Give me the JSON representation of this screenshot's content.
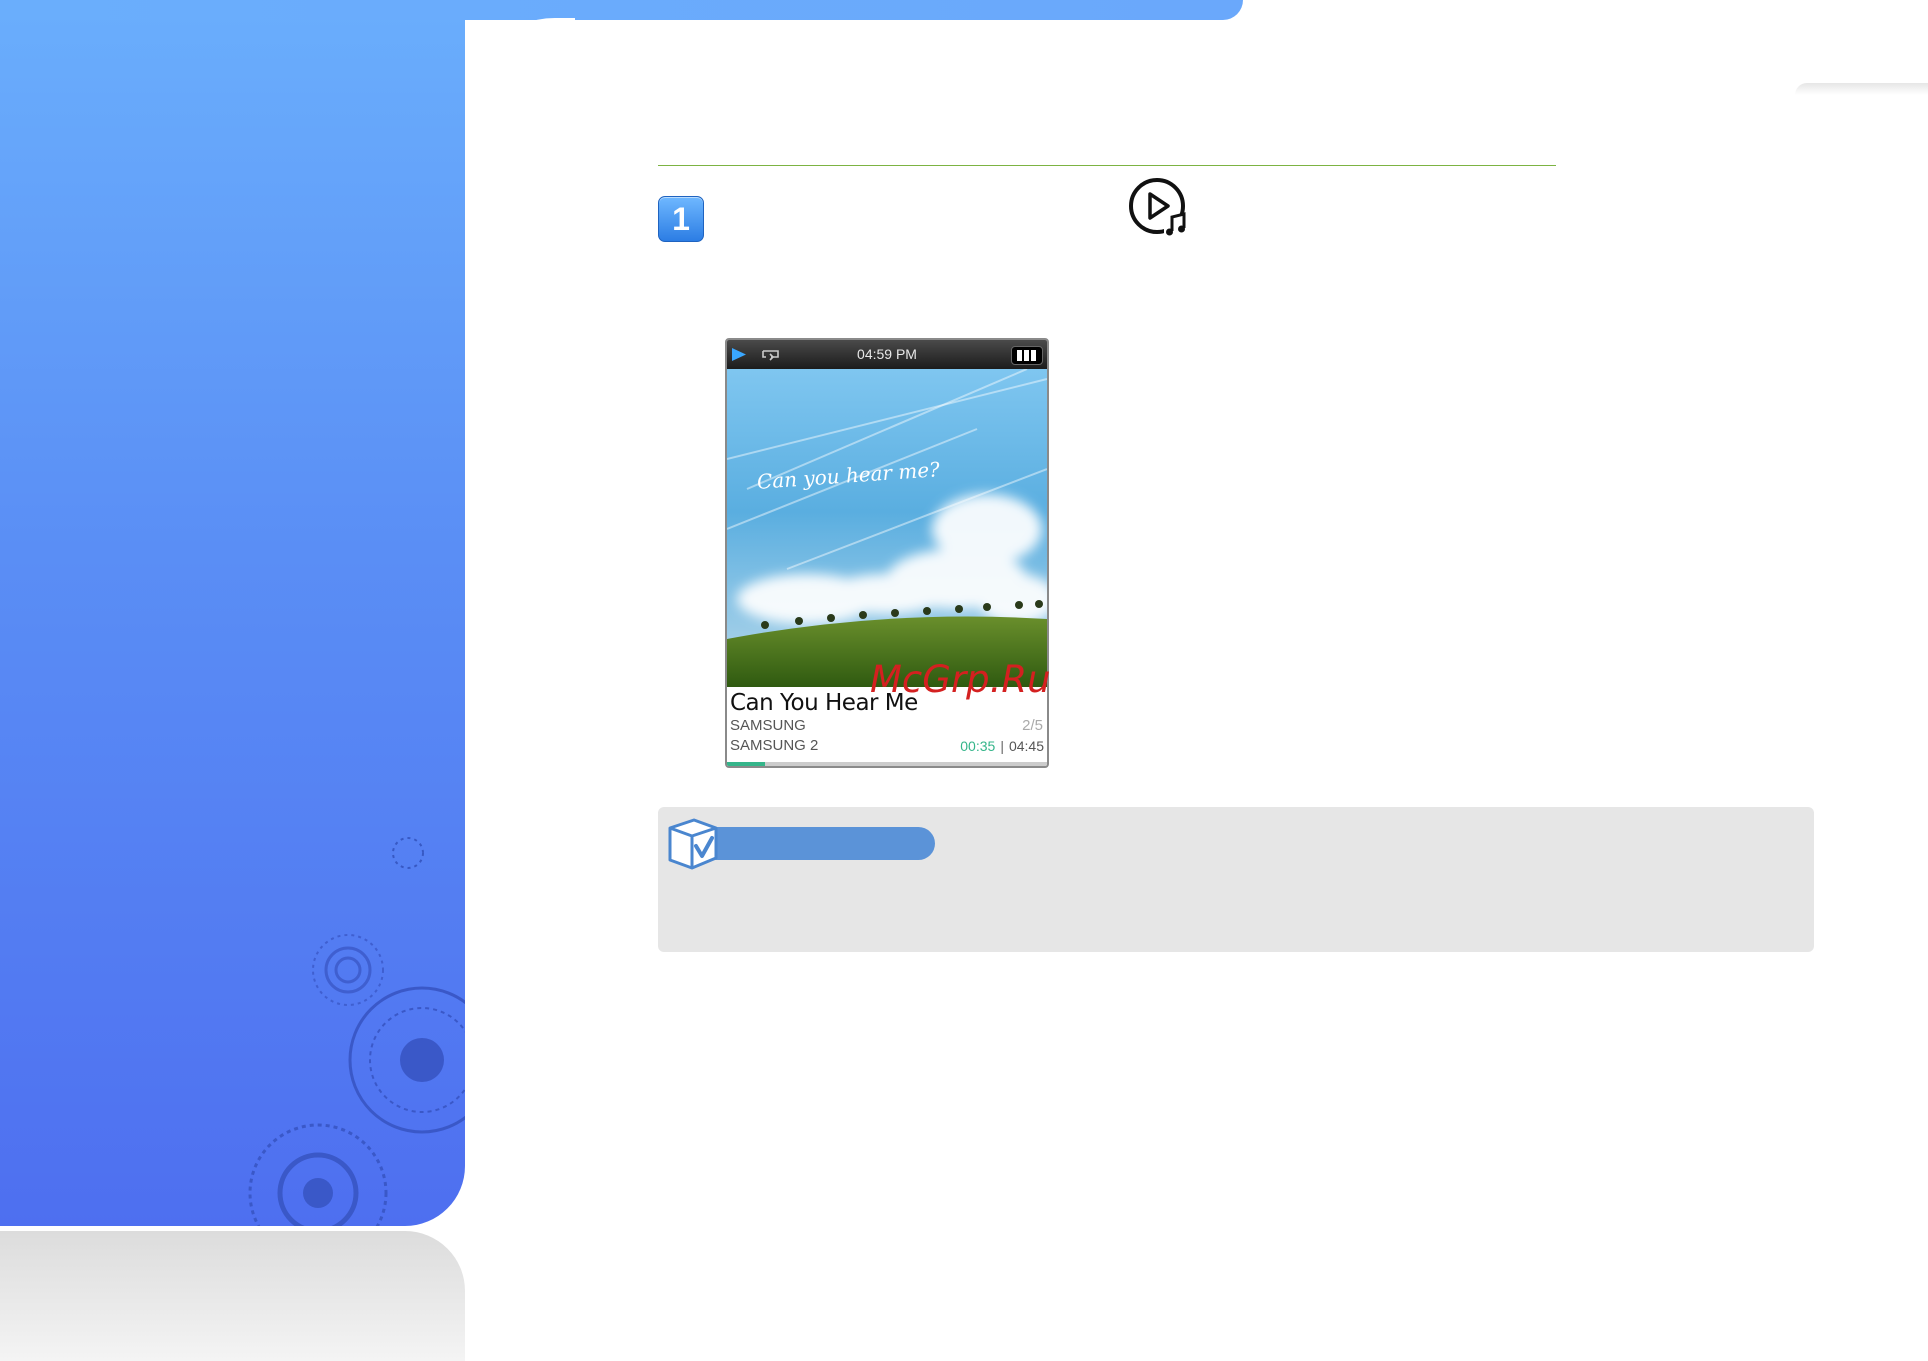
{
  "step": {
    "number": "1"
  },
  "device": {
    "status_time": "04:59 PM",
    "artwork_caption": "Can you hear me?",
    "song_title": "Can You Hear Me",
    "artist": "SAMSUNG",
    "album": "SAMSUNG 2",
    "track_count": "2/5",
    "elapsed": "00:35",
    "separator": "|",
    "total": "04:45",
    "progress": 0.12
  },
  "watermark": "McGrp.Ru",
  "icons": {
    "step_icon": "number-1-icon",
    "mode_icon": "music-play-icon",
    "note_icon": "checkbox-cube-icon"
  },
  "colors": {
    "sidebar": "#5a8ef5",
    "rule": "#7cb342",
    "progress": "#35b58a",
    "note_pill": "#5b93d8"
  }
}
